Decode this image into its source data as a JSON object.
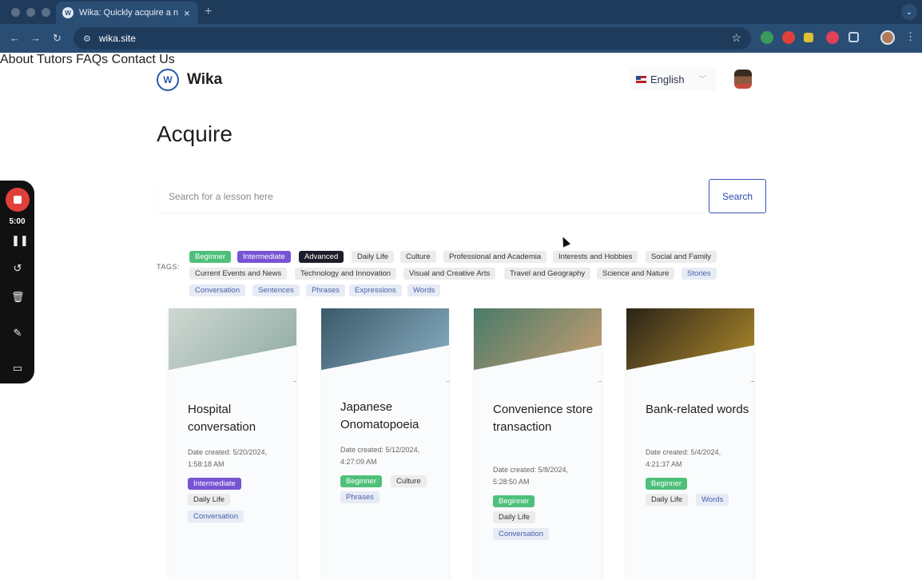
{
  "browser": {
    "tab_title": "Wika: Quickly acquire a new l",
    "url": "wika.site"
  },
  "site": {
    "brand": "Wika",
    "logo_letter": "W",
    "nav": [
      "About",
      "Tutors",
      "FAQs",
      "Contact Us"
    ],
    "language": "English"
  },
  "page": {
    "title": "Acquire",
    "search_placeholder": "Search for a lesson here",
    "search_button": "Search",
    "tags_label": "TAGS:"
  },
  "tags": [
    {
      "label": "Beginner",
      "style": "beginner"
    },
    {
      "label": "Intermediate",
      "style": "intermediate"
    },
    {
      "label": "Advanced",
      "style": "advanced"
    },
    {
      "label": "Daily Life",
      "style": "gray"
    },
    {
      "label": "Culture",
      "style": "gray"
    },
    {
      "label": "Professional and Academia",
      "style": "gray"
    },
    {
      "label": "Interests and Hobbies",
      "style": "gray"
    },
    {
      "label": "Social and Family",
      "style": "gray"
    },
    {
      "label": "Current Events and News",
      "style": "gray"
    },
    {
      "label": "Technology and Innovation",
      "style": "gray"
    },
    {
      "label": "Visual and Creative Arts",
      "style": "gray"
    },
    {
      "label": "Travel and Geography",
      "style": "gray"
    },
    {
      "label": "Science and Nature",
      "style": "gray"
    },
    {
      "label": "Stories",
      "style": "blue"
    },
    {
      "label": "Conversation",
      "style": "blue"
    },
    {
      "label": "Sentences",
      "style": "blue"
    },
    {
      "label": "Phrases",
      "style": "blue"
    },
    {
      "label": "Expressions",
      "style": "blue"
    },
    {
      "label": "Words",
      "style": "blue"
    }
  ],
  "lessons": [
    {
      "title": "Hospital conversation",
      "date": "Date created: 5/20/2024, 1:58:18 AM",
      "image_colors": [
        "#cfd8d2",
        "#8aa8a0"
      ],
      "tags": [
        {
          "label": "Intermediate",
          "style": "intermediate"
        },
        {
          "label": "Daily Life",
          "style": "gray"
        },
        {
          "label": "Conversation",
          "style": "blue"
        }
      ]
    },
    {
      "title": "Japanese Onomatopoeia",
      "date": "Date created: 5/12/2024, 4:27:09 AM",
      "image_colors": [
        "#3a5a6a",
        "#8fb4c8"
      ],
      "tags": [
        {
          "label": "Beginner",
          "style": "beginner"
        },
        {
          "label": "Culture",
          "style": "gray"
        },
        {
          "label": "Phrases",
          "style": "blue"
        }
      ]
    },
    {
      "title": "Convenience store transaction",
      "date": "Date created: 5/8/2024, 5:28:50 AM",
      "image_colors": [
        "#4a7a6a",
        "#d0a070"
      ],
      "tags": [
        {
          "label": "Beginner",
          "style": "beginner"
        },
        {
          "label": "Daily Life",
          "style": "gray"
        },
        {
          "label": "Conversation",
          "style": "blue"
        }
      ]
    },
    {
      "title": "Bank-related words",
      "date": "Date created: 5/4/2024, 4:21:37 AM",
      "image_colors": [
        "#2a2418",
        "#b8902e"
      ],
      "tags": [
        {
          "label": "Beginner",
          "style": "beginner"
        },
        {
          "label": "Daily Life",
          "style": "gray"
        },
        {
          "label": "Words",
          "style": "blue"
        }
      ]
    }
  ],
  "recorder": {
    "time": "5:00"
  }
}
